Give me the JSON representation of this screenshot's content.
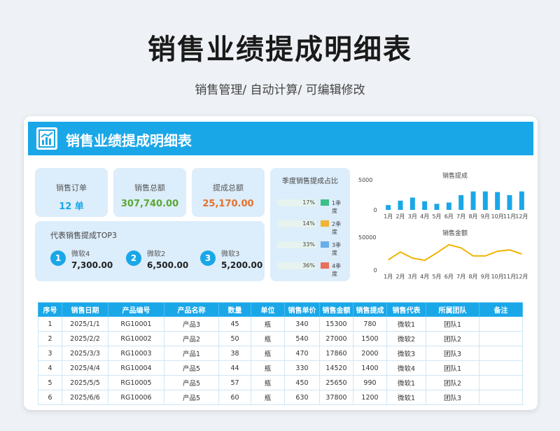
{
  "page": {
    "title": "销售业绩提成明细表",
    "subtitle": "销售管理/ 自动计算/ 可编辑修改"
  },
  "card": {
    "header_title": "销售业绩提成明细表"
  },
  "kpis": [
    {
      "label": "销售订单",
      "value": "12 单",
      "color": "#1aa7e8"
    },
    {
      "label": "销售总额",
      "value": "307,740.00",
      "color": "#5aa832"
    },
    {
      "label": "提成总额",
      "value": "25,170.00",
      "color": "#e8702a"
    }
  ],
  "top3": {
    "title": "代表销售提成TOP3",
    "items": [
      {
        "rank": "1",
        "name": "微软4",
        "value": "7,300.00"
      },
      {
        "rank": "2",
        "name": "微软2",
        "value": "6,500.00"
      },
      {
        "rank": "3",
        "name": "微软3",
        "value": "5,200.00"
      }
    ]
  },
  "quarter": {
    "title": "季度销售提成占比",
    "items": [
      {
        "pct": "17%",
        "label": "1季度",
        "color": "#3dbf8a"
      },
      {
        "pct": "14%",
        "label": "2季度",
        "color": "#f0b432"
      },
      {
        "pct": "33%",
        "label": "3季度",
        "color": "#6aaee8"
      },
      {
        "pct": "36%",
        "label": "4季度",
        "color": "#e8705a"
      }
    ]
  },
  "chart_data": [
    {
      "type": "bar",
      "title": "销售提成",
      "categories": [
        "1月",
        "2月",
        "3月",
        "4月",
        "5月",
        "6月",
        "7月",
        "8月",
        "9月",
        "10月",
        "11月",
        "12月"
      ],
      "values": [
        780,
        1500,
        2000,
        1400,
        990,
        1200,
        2400,
        3000,
        3000,
        2900,
        2400,
        3000
      ],
      "ylim": [
        0,
        5000
      ],
      "y_ticks": [
        "5000",
        "0"
      ],
      "color": "#1aa7e8"
    },
    {
      "type": "line",
      "title": "销售金额",
      "categories": [
        "1月",
        "2月",
        "3月",
        "4月",
        "5月",
        "6月",
        "7月",
        "8月",
        "9月",
        "10月",
        "11月",
        "12月"
      ],
      "values": [
        15300,
        27000,
        17860,
        14520,
        25650,
        37800,
        33000,
        21000,
        21000,
        28000,
        30000,
        24000
      ],
      "ylim": [
        0,
        50000
      ],
      "y_ticks": [
        "50000",
        "0"
      ],
      "color": "#f0b400"
    }
  ],
  "table": {
    "headers": [
      "序号",
      "销售日期",
      "产品编号",
      "产品名称",
      "数量",
      "单位",
      "销售单价",
      "销售金额",
      "销售提成",
      "销售代表",
      "所属团队",
      "备注"
    ],
    "rows": [
      [
        "1",
        "2025/1/1",
        "RG10001",
        "产品3",
        "45",
        "瓶",
        "340",
        "15300",
        "780",
        "微软1",
        "团队1",
        ""
      ],
      [
        "2",
        "2025/2/2",
        "RG10002",
        "产品2",
        "50",
        "瓶",
        "540",
        "27000",
        "1500",
        "微软2",
        "团队2",
        ""
      ],
      [
        "3",
        "2025/3/3",
        "RG10003",
        "产品1",
        "38",
        "瓶",
        "470",
        "17860",
        "2000",
        "微软3",
        "团队3",
        ""
      ],
      [
        "4",
        "2025/4/4",
        "RG10004",
        "产品5",
        "44",
        "瓶",
        "330",
        "14520",
        "1400",
        "微软4",
        "团队1",
        ""
      ],
      [
        "5",
        "2025/5/5",
        "RG10005",
        "产品5",
        "57",
        "瓶",
        "450",
        "25650",
        "990",
        "微软1",
        "团队2",
        ""
      ],
      [
        "6",
        "2025/6/6",
        "RG10006",
        "产品5",
        "60",
        "瓶",
        "630",
        "37800",
        "1200",
        "微软1",
        "团队3",
        ""
      ]
    ]
  }
}
